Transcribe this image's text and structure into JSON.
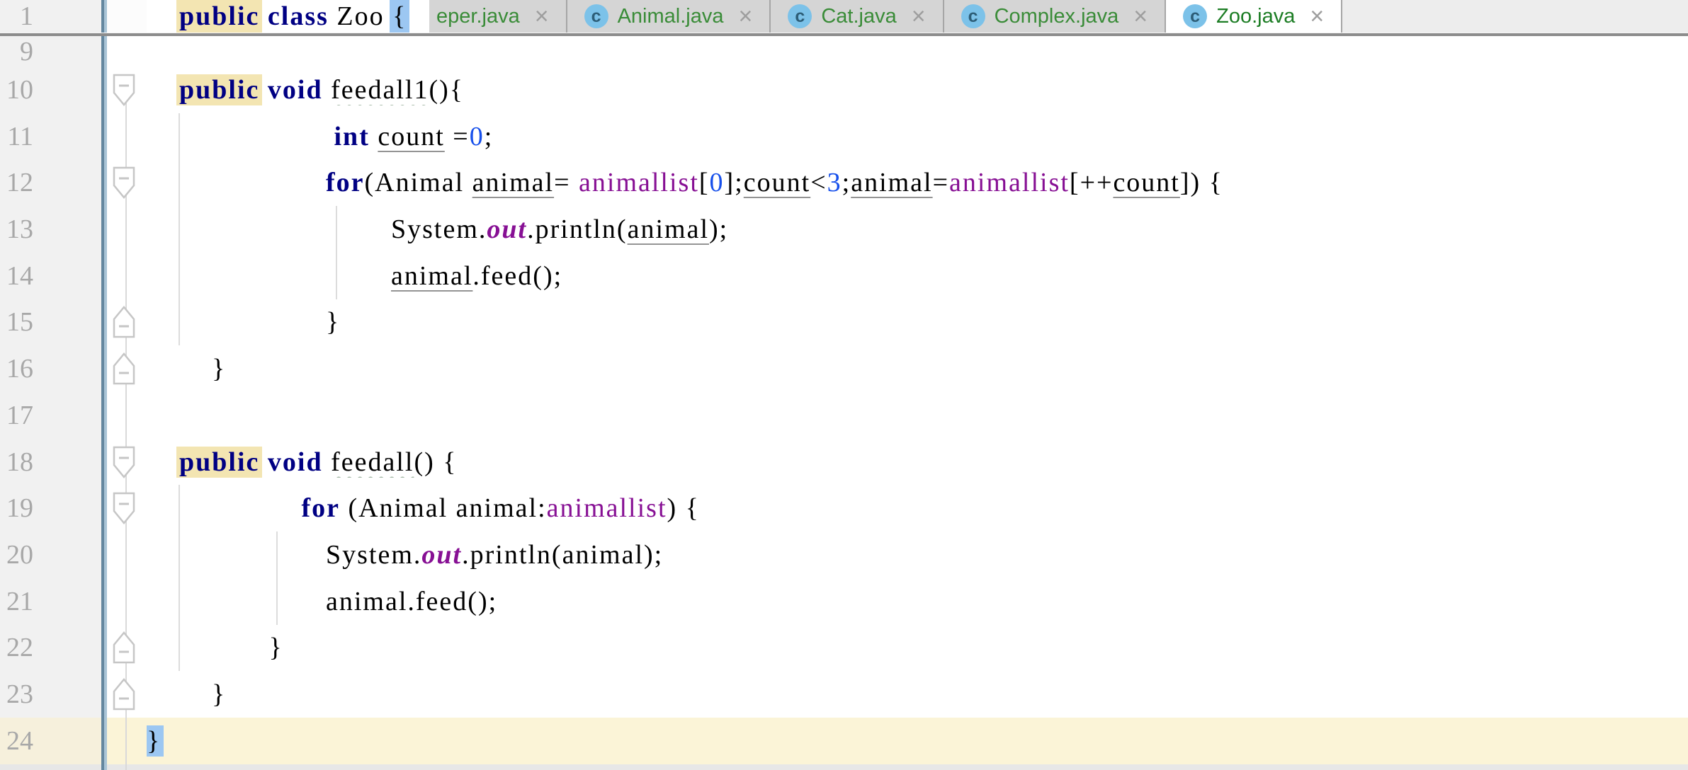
{
  "app": {
    "title": "IntelliJ IDEA editor - Zoo.java"
  },
  "colors": {
    "keyword_navy": "#000083",
    "field_purple": "#871094",
    "number_blue": "#1750eb",
    "identifier_highlight_yellow": "#f3e5b2",
    "brace_match_blue": "#9cc7f2",
    "caret_row_yellow": "#fbf4d7",
    "tab_text_green": "#3a8c38",
    "class_icon_blue": "#7cc2e9",
    "vcs_change_bar_blue": "#64879f"
  },
  "header": {
    "close_glyph": "×",
    "class_icon_letter": "c",
    "tabs": [
      {
        "label": "eper.java",
        "icon": false,
        "cut": true,
        "active": false
      },
      {
        "label": "Animal.java",
        "icon": true,
        "cut": false,
        "active": false
      },
      {
        "label": "Cat.java",
        "icon": true,
        "cut": false,
        "active": false
      },
      {
        "label": "Complex.java",
        "icon": true,
        "cut": false,
        "active": false
      },
      {
        "label": "Zoo.java",
        "icon": true,
        "cut": false,
        "active": true
      }
    ]
  },
  "sticky_line": {
    "number": "1",
    "tokens": [
      [
        "    "
      ],
      [
        "public",
        "kwhl"
      ],
      [
        " "
      ],
      [
        "class",
        "kw"
      ],
      [
        " Zoo "
      ],
      [
        "{",
        "bracehl"
      ]
    ]
  },
  "editor": {
    "lines": [
      {
        "n": "9",
        "partial": true,
        "tokens": []
      },
      {
        "n": "10",
        "fold": "down",
        "tokens": [
          [
            "    "
          ],
          [
            "public",
            "kwhl"
          ],
          [
            " "
          ],
          [
            "void",
            "kw"
          ],
          [
            " "
          ],
          [
            "feedall1",
            "typo"
          ],
          [
            "(){"
          ]
        ]
      },
      {
        "n": "11",
        "tokens": [
          [
            "                       "
          ],
          [
            "int",
            "kw"
          ],
          [
            " "
          ],
          [
            "count",
            "varu"
          ],
          [
            " ="
          ],
          [
            "0",
            "num"
          ],
          [
            ";"
          ]
        ]
      },
      {
        "n": "12",
        "fold": "down",
        "tokens": [
          [
            "                      "
          ],
          [
            "for",
            "kw"
          ],
          [
            "(Animal "
          ],
          [
            "animal",
            "varu"
          ],
          [
            "= "
          ],
          [
            "animallist",
            "field"
          ],
          [
            "["
          ],
          [
            "0",
            "num"
          ],
          [
            "];"
          ],
          [
            "count",
            "varu"
          ],
          [
            "<"
          ],
          [
            "3",
            "num"
          ],
          [
            ";"
          ],
          [
            "animal",
            "varu"
          ],
          [
            "="
          ],
          [
            "animallist",
            "field"
          ],
          [
            "[++"
          ],
          [
            "count",
            "varu"
          ],
          [
            "]) {"
          ]
        ]
      },
      {
        "n": "13",
        "tokens": [
          [
            "                              "
          ],
          [
            "System."
          ],
          [
            "out",
            "static"
          ],
          [
            ".println("
          ],
          [
            "animal",
            "varu"
          ],
          [
            ");"
          ]
        ]
      },
      {
        "n": "14",
        "tokens": [
          [
            "                              "
          ],
          [
            "animal",
            "varu"
          ],
          [
            ".feed();"
          ]
        ]
      },
      {
        "n": "15",
        "fold": "up",
        "tokens": [
          [
            "                      }"
          ]
        ]
      },
      {
        "n": "16",
        "fold": "up",
        "tokens": [
          [
            "        }"
          ]
        ]
      },
      {
        "n": "17",
        "tokens": []
      },
      {
        "n": "18",
        "fold": "down",
        "tokens": [
          [
            "    "
          ],
          [
            "public",
            "kwhl"
          ],
          [
            " "
          ],
          [
            "void",
            "kw"
          ],
          [
            " "
          ],
          [
            "feedall",
            "typo"
          ],
          [
            "() {"
          ]
        ]
      },
      {
        "n": "19",
        "fold": "down",
        "tokens": [
          [
            "                   "
          ],
          [
            "for",
            "kw"
          ],
          [
            " (Animal animal:"
          ],
          [
            "animallist",
            "field"
          ],
          [
            ") {"
          ]
        ]
      },
      {
        "n": "20",
        "tokens": [
          [
            "                      "
          ],
          [
            "System."
          ],
          [
            "out",
            "static"
          ],
          [
            ".println(animal);"
          ]
        ]
      },
      {
        "n": "21",
        "tokens": [
          [
            "                      "
          ],
          [
            "animal.feed();"
          ]
        ]
      },
      {
        "n": "22",
        "fold": "up",
        "tokens": [
          [
            "               }"
          ]
        ]
      },
      {
        "n": "23",
        "fold": "up",
        "tokens": [
          [
            "        }"
          ]
        ]
      },
      {
        "n": "24",
        "caret": true,
        "tokens": [
          [
            "}",
            "bracehl"
          ]
        ]
      }
    ]
  }
}
